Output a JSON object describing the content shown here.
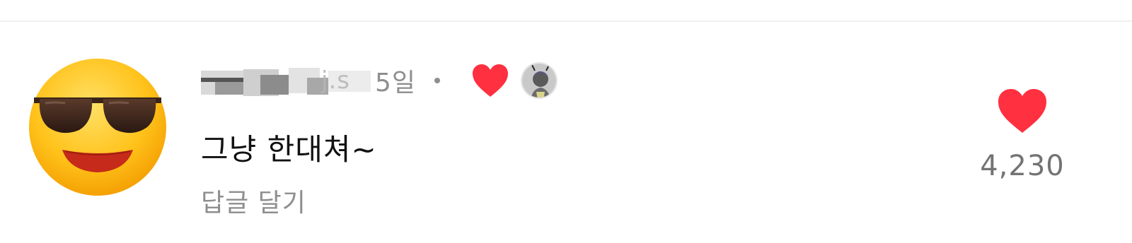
{
  "comment": {
    "avatar_icon": "smiling-face-with-sunglasses-icon",
    "username_suffix": "j.s",
    "time_label": "5일",
    "separator": "•",
    "creator_liked_icon": "heart-icon",
    "creator_avatar_icon": "creator-avatar-icon",
    "text": "그냥 한대쳐~",
    "reply_label": "답글 달기",
    "like_icon": "heart-icon",
    "like_count": "4,230",
    "colors": {
      "heart": "#ff3040",
      "secondary_text": "#8e8e8e",
      "primary_text": "#111111"
    }
  }
}
